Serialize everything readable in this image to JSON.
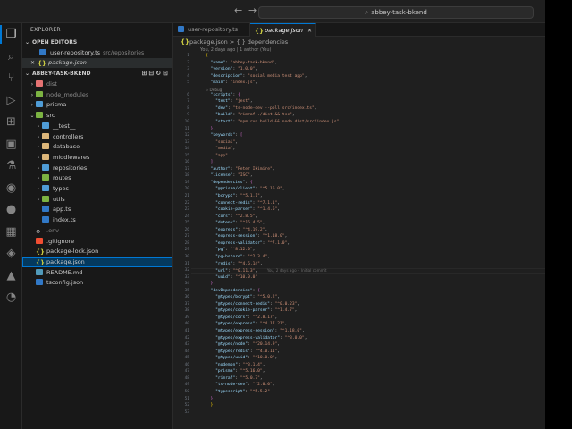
{
  "titlebar": {
    "back": "←",
    "forward": "→",
    "search_text": "abbey-task-bkend"
  },
  "activity": [
    "files-icon",
    "search-icon",
    "source-control-icon",
    "run-debug-icon",
    "extensions-icon",
    "remote-explorer-icon",
    "testing-icon",
    "git-graph-icon",
    "github-icon",
    "docker-icon",
    "live-share-icon",
    "deploy-icon",
    "timeline-icon"
  ],
  "sidebar": {
    "title": "EXPLORER",
    "open_editors": {
      "label": "OPEN EDITORS",
      "items": [
        {
          "name": "user-repository.ts",
          "path": "src/repositories"
        },
        {
          "name": "package.json",
          "path": ""
        }
      ]
    },
    "project": {
      "label": "ABBEY-TASK-BKEND",
      "tree": [
        {
          "name": "dist",
          "indent": 1,
          "kind": "folder-red",
          "chev": "›"
        },
        {
          "name": "node_modules",
          "indent": 1,
          "kind": "folder-green",
          "chev": "›"
        },
        {
          "name": "prisma",
          "indent": 1,
          "kind": "folder-blue",
          "chev": "›"
        },
        {
          "name": "src",
          "indent": 1,
          "kind": "folder-green",
          "chev": "⌄"
        },
        {
          "name": "__test__",
          "indent": 2,
          "kind": "folder-blue",
          "chev": "›"
        },
        {
          "name": "controllers",
          "indent": 2,
          "kind": "folder",
          "chev": "›"
        },
        {
          "name": "database",
          "indent": 2,
          "kind": "folder",
          "chev": "›"
        },
        {
          "name": "middlewares",
          "indent": 2,
          "kind": "folder",
          "chev": "›"
        },
        {
          "name": "repositories",
          "indent": 2,
          "kind": "folder-blue",
          "chev": "›"
        },
        {
          "name": "routes",
          "indent": 2,
          "kind": "folder-green",
          "chev": "›"
        },
        {
          "name": "types",
          "indent": 2,
          "kind": "folder-blue",
          "chev": "›"
        },
        {
          "name": "utils",
          "indent": 2,
          "kind": "folder-green",
          "chev": "›"
        },
        {
          "name": "app.ts",
          "indent": 2,
          "kind": "ts-ic",
          "chev": ""
        },
        {
          "name": "index.ts",
          "indent": 2,
          "kind": "ts-ic",
          "chev": ""
        },
        {
          "name": ".env",
          "indent": 1,
          "kind": "env-ic",
          "chev": ""
        },
        {
          "name": ".gitignore",
          "indent": 1,
          "kind": "git-ic",
          "chev": ""
        },
        {
          "name": "package-lock.json",
          "indent": 1,
          "kind": "json-ic",
          "chev": ""
        },
        {
          "name": "package.json",
          "indent": 1,
          "kind": "json-ic",
          "chev": ""
        },
        {
          "name": "README.md",
          "indent": 1,
          "kind": "md-ic",
          "chev": ""
        },
        {
          "name": "tsconfig.json",
          "indent": 1,
          "kind": "cfg-ic",
          "chev": ""
        }
      ]
    }
  },
  "editor": {
    "tabs": [
      {
        "name": "user-repository.ts"
      },
      {
        "name": "package.json"
      }
    ],
    "breadcrumb": {
      "file": "package.json",
      "sep": ">",
      "node": "{ } dependencies"
    },
    "blame_header": "You, 2 days ago | 1 author (You)",
    "debug_lens": "▷ Debug",
    "inline_blame": "You, 2 days ago • Initial commit",
    "lines": [
      [
        [
          "b",
          "{"
        ]
      ],
      [
        [
          "k",
          "\"name\""
        ],
        [
          "c",
          ": "
        ],
        [
          "s",
          "\"abbey-task-bkend\""
        ],
        [
          "c",
          ","
        ]
      ],
      [
        [
          "k",
          "\"version\""
        ],
        [
          "c",
          ": "
        ],
        [
          "s",
          "\"1.0.0\""
        ],
        [
          "c",
          ","
        ]
      ],
      [
        [
          "k",
          "\"description\""
        ],
        [
          "c",
          ": "
        ],
        [
          "s",
          "\"social media test app\""
        ],
        [
          "c",
          ","
        ]
      ],
      [
        [
          "k",
          "\"main\""
        ],
        [
          "c",
          ": "
        ],
        [
          "s",
          "\"index.js\""
        ],
        [
          "c",
          ","
        ]
      ],
      [
        [
          "k",
          "\"scripts\""
        ],
        [
          "c",
          ": "
        ],
        [
          "p",
          "{"
        ]
      ],
      [
        [
          "c",
          "  "
        ],
        [
          "k",
          "\"test\""
        ],
        [
          "c",
          ": "
        ],
        [
          "s",
          "\"jest\""
        ],
        [
          "c",
          ","
        ]
      ],
      [
        [
          "c",
          "  "
        ],
        [
          "k",
          "\"dev\""
        ],
        [
          "c",
          ": "
        ],
        [
          "s",
          "\"ts-node-dev --poll src/index.ts\""
        ],
        [
          "c",
          ","
        ]
      ],
      [
        [
          "c",
          "  "
        ],
        [
          "k",
          "\"build\""
        ],
        [
          "c",
          ": "
        ],
        [
          "s",
          "\"rimraf ./dist && tsc\""
        ],
        [
          "c",
          ","
        ]
      ],
      [
        [
          "c",
          "  "
        ],
        [
          "k",
          "\"start\""
        ],
        [
          "c",
          ": "
        ],
        [
          "s",
          "\"npm run build && node dist/src/index.js\""
        ]
      ],
      [
        [
          "p",
          "},"
        ]
      ],
      [
        [
          "k",
          "\"keywords\""
        ],
        [
          "c",
          ": "
        ],
        [
          "p",
          "["
        ]
      ],
      [
        [
          "c",
          "  "
        ],
        [
          "s",
          "\"social\""
        ],
        [
          "c",
          ","
        ]
      ],
      [
        [
          "c",
          "  "
        ],
        [
          "s",
          "\"media\""
        ],
        [
          "c",
          ","
        ]
      ],
      [
        [
          "c",
          "  "
        ],
        [
          "s",
          "\"app\""
        ]
      ],
      [
        [
          "p",
          "],"
        ]
      ],
      [
        [
          "k",
          "\"author\""
        ],
        [
          "c",
          ": "
        ],
        [
          "s",
          "\"Peter Ikimire\""
        ],
        [
          "c",
          ","
        ]
      ],
      [
        [
          "k",
          "\"license\""
        ],
        [
          "c",
          ": "
        ],
        [
          "s",
          "\"ISC\""
        ],
        [
          "c",
          ","
        ]
      ],
      [
        [
          "k",
          "\"dependencies\""
        ],
        [
          "c",
          ": "
        ],
        [
          "p",
          "{"
        ]
      ],
      [
        [
          "c",
          "  "
        ],
        [
          "k",
          "\"@prisma/client\""
        ],
        [
          "c",
          ": "
        ],
        [
          "s",
          "\"^5.16.0\""
        ],
        [
          "c",
          ","
        ]
      ],
      [
        [
          "c",
          "  "
        ],
        [
          "k",
          "\"bcrypt\""
        ],
        [
          "c",
          ": "
        ],
        [
          "s",
          "\"^5.1.1\""
        ],
        [
          "c",
          ","
        ]
      ],
      [
        [
          "c",
          "  "
        ],
        [
          "k",
          "\"connect-redis\""
        ],
        [
          "c",
          ": "
        ],
        [
          "s",
          "\"^7.1.1\""
        ],
        [
          "c",
          ","
        ]
      ],
      [
        [
          "c",
          "  "
        ],
        [
          "k",
          "\"cookie-parser\""
        ],
        [
          "c",
          ": "
        ],
        [
          "s",
          "\"^1.4.6\""
        ],
        [
          "c",
          ","
        ]
      ],
      [
        [
          "c",
          "  "
        ],
        [
          "k",
          "\"cors\""
        ],
        [
          "c",
          ": "
        ],
        [
          "s",
          "\"^2.8.5\""
        ],
        [
          "c",
          ","
        ]
      ],
      [
        [
          "c",
          "  "
        ],
        [
          "k",
          "\"dotenv\""
        ],
        [
          "c",
          ": "
        ],
        [
          "s",
          "\"^16.4.5\""
        ],
        [
          "c",
          ","
        ]
      ],
      [
        [
          "c",
          "  "
        ],
        [
          "k",
          "\"express\""
        ],
        [
          "c",
          ": "
        ],
        [
          "s",
          "\"^4.19.2\""
        ],
        [
          "c",
          ","
        ]
      ],
      [
        [
          "c",
          "  "
        ],
        [
          "k",
          "\"express-session\""
        ],
        [
          "c",
          ": "
        ],
        [
          "s",
          "\"^1.18.0\""
        ],
        [
          "c",
          ","
        ]
      ],
      [
        [
          "c",
          "  "
        ],
        [
          "k",
          "\"express-validator\""
        ],
        [
          "c",
          ": "
        ],
        [
          "s",
          "\"^7.1.0\""
        ],
        [
          "c",
          ","
        ]
      ],
      [
        [
          "c",
          "  "
        ],
        [
          "k",
          "\"pg\""
        ],
        [
          "c",
          ": "
        ],
        [
          "s",
          "\"^8.12.0\""
        ],
        [
          "c",
          ","
        ]
      ],
      [
        [
          "c",
          "  "
        ],
        [
          "k",
          "\"pg-hstore\""
        ],
        [
          "c",
          ": "
        ],
        [
          "s",
          "\"^2.3.4\""
        ],
        [
          "c",
          ","
        ]
      ],
      [
        [
          "c",
          "  "
        ],
        [
          "k",
          "\"redis\""
        ],
        [
          "c",
          ": "
        ],
        [
          "s",
          "\"^4.6.14\""
        ],
        [
          "c",
          ","
        ]
      ],
      [
        [
          "c",
          "  "
        ],
        [
          "k",
          "\"url\""
        ],
        [
          "c",
          ": "
        ],
        [
          "s",
          "\"^0.11.3\""
        ],
        [
          "c",
          ","
        ]
      ],
      [
        [
          "c",
          "  "
        ],
        [
          "k",
          "\"uuid\""
        ],
        [
          "c",
          ": "
        ],
        [
          "s",
          "\"^10.0.0\""
        ]
      ],
      [
        [
          "p",
          "},"
        ]
      ],
      [
        [
          "k",
          "\"devDependencies\""
        ],
        [
          "c",
          ": "
        ],
        [
          "p",
          "{"
        ]
      ],
      [
        [
          "c",
          "  "
        ],
        [
          "k",
          "\"@types/bcrypt\""
        ],
        [
          "c",
          ": "
        ],
        [
          "s",
          "\"^5.0.2\""
        ],
        [
          "c",
          ","
        ]
      ],
      [
        [
          "c",
          "  "
        ],
        [
          "k",
          "\"@types/connect-redis\""
        ],
        [
          "c",
          ": "
        ],
        [
          "s",
          "\"^0.0.23\""
        ],
        [
          "c",
          ","
        ]
      ],
      [
        [
          "c",
          "  "
        ],
        [
          "k",
          "\"@types/cookie-parser\""
        ],
        [
          "c",
          ": "
        ],
        [
          "s",
          "\"^1.4.7\""
        ],
        [
          "c",
          ","
        ]
      ],
      [
        [
          "c",
          "  "
        ],
        [
          "k",
          "\"@types/cors\""
        ],
        [
          "c",
          ": "
        ],
        [
          "s",
          "\"^2.8.17\""
        ],
        [
          "c",
          ","
        ]
      ],
      [
        [
          "c",
          "  "
        ],
        [
          "k",
          "\"@types/express\""
        ],
        [
          "c",
          ": "
        ],
        [
          "s",
          "\"^4.17.21\""
        ],
        [
          "c",
          ","
        ]
      ],
      [
        [
          "c",
          "  "
        ],
        [
          "k",
          "\"@types/express-session\""
        ],
        [
          "c",
          ": "
        ],
        [
          "s",
          "\"^1.18.0\""
        ],
        [
          "c",
          ","
        ]
      ],
      [
        [
          "c",
          "  "
        ],
        [
          "k",
          "\"@types/express-validator\""
        ],
        [
          "c",
          ": "
        ],
        [
          "s",
          "\"^3.0.0\""
        ],
        [
          "c",
          ","
        ]
      ],
      [
        [
          "c",
          "  "
        ],
        [
          "k",
          "\"@types/node\""
        ],
        [
          "c",
          ": "
        ],
        [
          "s",
          "\"^20.14.9\""
        ],
        [
          "c",
          ","
        ]
      ],
      [
        [
          "c",
          "  "
        ],
        [
          "k",
          "\"@types/redis\""
        ],
        [
          "c",
          ": "
        ],
        [
          "s",
          "\"^4.0.11\""
        ],
        [
          "c",
          ","
        ]
      ],
      [
        [
          "c",
          "  "
        ],
        [
          "k",
          "\"@types/uuid\""
        ],
        [
          "c",
          ": "
        ],
        [
          "s",
          "\"^10.0.0\""
        ],
        [
          "c",
          ","
        ]
      ],
      [
        [
          "c",
          "  "
        ],
        [
          "k",
          "\"nodemon\""
        ],
        [
          "c",
          ": "
        ],
        [
          "s",
          "\"^3.1.4\""
        ],
        [
          "c",
          ","
        ]
      ],
      [
        [
          "c",
          "  "
        ],
        [
          "k",
          "\"prisma\""
        ],
        [
          "c",
          ": "
        ],
        [
          "s",
          "\"^5.16.0\""
        ],
        [
          "c",
          ","
        ]
      ],
      [
        [
          "c",
          "  "
        ],
        [
          "k",
          "\"rimraf\""
        ],
        [
          "c",
          ": "
        ],
        [
          "s",
          "\"^5.0.7\""
        ],
        [
          "c",
          ","
        ]
      ],
      [
        [
          "c",
          "  "
        ],
        [
          "k",
          "\"ts-node-dev\""
        ],
        [
          "c",
          ": "
        ],
        [
          "s",
          "\"^2.0.0\""
        ],
        [
          "c",
          ","
        ]
      ],
      [
        [
          "c",
          "  "
        ],
        [
          "k",
          "\"typescript\""
        ],
        [
          "c",
          ": "
        ],
        [
          "s",
          "\"^5.5.2\""
        ]
      ],
      [
        [
          "p",
          "}"
        ]
      ],
      [
        [
          "b",
          "}"
        ]
      ],
      []
    ]
  }
}
